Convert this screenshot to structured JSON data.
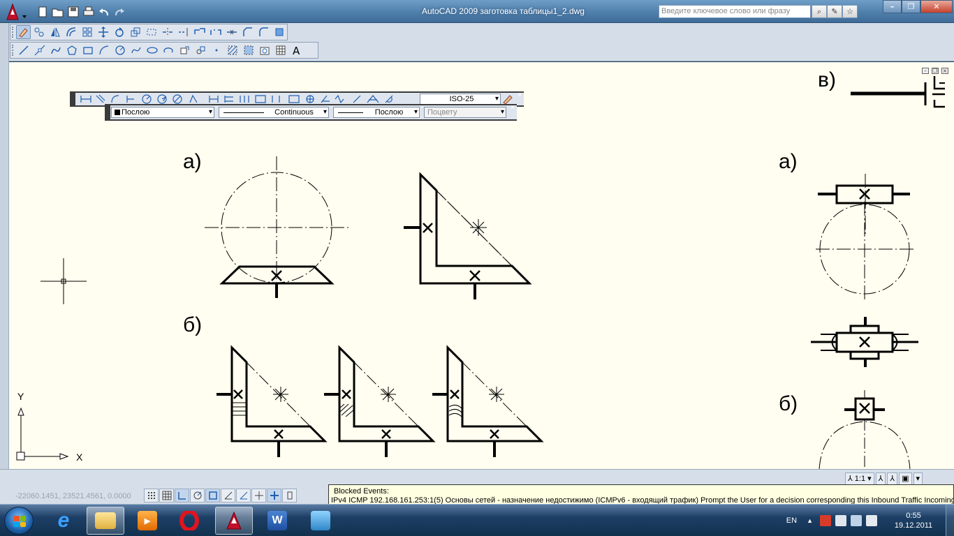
{
  "window": {
    "title": "AutoCAD 2009 заготовка таблицы1_2.dwg",
    "search_placeholder": "Введите ключевое слово или фразу"
  },
  "icons": {
    "app": "autocad-a-icon",
    "qat": [
      "new-icon",
      "open-icon",
      "save-icon",
      "print-icon",
      "undo-icon",
      "redo-icon"
    ],
    "modify_toolbar": [
      "erase-icon",
      "copy-icon",
      "mirror-icon",
      "offset-icon",
      "array-icon",
      "move-icon",
      "rotate-icon",
      "scale-icon",
      "stretch-icon",
      "trim-icon",
      "extend-icon",
      "break-at-point-icon",
      "break-icon",
      "join-icon",
      "chamfer-icon",
      "fillet-icon",
      "explode-icon"
    ],
    "draw_toolbar": [
      "line-icon",
      "construction-line-icon",
      "polyline-icon",
      "polygon-icon",
      "rectangle-icon",
      "arc-icon",
      "circle-icon",
      "spline-icon",
      "ellipse-icon",
      "ellipse-arc-icon",
      "insert-block-icon",
      "make-block-icon",
      "point-icon",
      "hatch-icon",
      "gradient-icon",
      "region-icon",
      "table-icon",
      "multiline-text-icon"
    ],
    "dimension_toolbar": [
      "linear-dim-icon",
      "aligned-dim-icon",
      "arc-length-icon",
      "ordinate-dim-icon",
      "radius-dim-icon",
      "jogged-dim-icon",
      "diameter-dim-icon",
      "angular-dim-icon",
      "quick-dim-icon",
      "baseline-dim-icon",
      "continue-dim-icon",
      "dim-space-icon",
      "dim-break-icon",
      "tolerance-icon",
      "center-mark-icon",
      "inspection-icon",
      "jogged-linear-icon",
      "dim-edit-icon",
      "dim-text-edit-icon",
      "dim-update-icon"
    ]
  },
  "dimension_style": "ISO-25",
  "properties": {
    "color": "Послою",
    "linetype": "Continuous",
    "lineweight": "Послою",
    "plotstyle": "Поцвету"
  },
  "drawing_labels": {
    "a_left": "а)",
    "b_left": "б)",
    "a_right": "а)",
    "b_right": "б)",
    "v_right": "в)"
  },
  "ucs": {
    "x": "X",
    "y": "Y"
  },
  "status": {
    "coords": "-22060.1451, 23521.4561, 0.0000",
    "annotation_scale": "1:1"
  },
  "notification": {
    "title": "Blocked Events:",
    "text": "IPv4 ICMP 192.168.161.253:1(5) Основы сетей - назначение недостижимо (ICMPv6 - входящий трафик) Prompt the User for a decision corresponding this Inbound Traffic Incoming"
  },
  "taskbar": {
    "apps": [
      "explorer-icon",
      "internet-explorer-icon",
      "folder-icon",
      "media-player-icon",
      "opera-icon",
      "autocad-icon",
      "word-icon",
      "control-panel-icon"
    ],
    "lang": "EN",
    "time": "0:55",
    "date": "19.12.2011"
  },
  "colors": {
    "canvas_bg": "#fffef0",
    "titlebar": "#4f7fab",
    "taskbar": "#1d3f66"
  }
}
